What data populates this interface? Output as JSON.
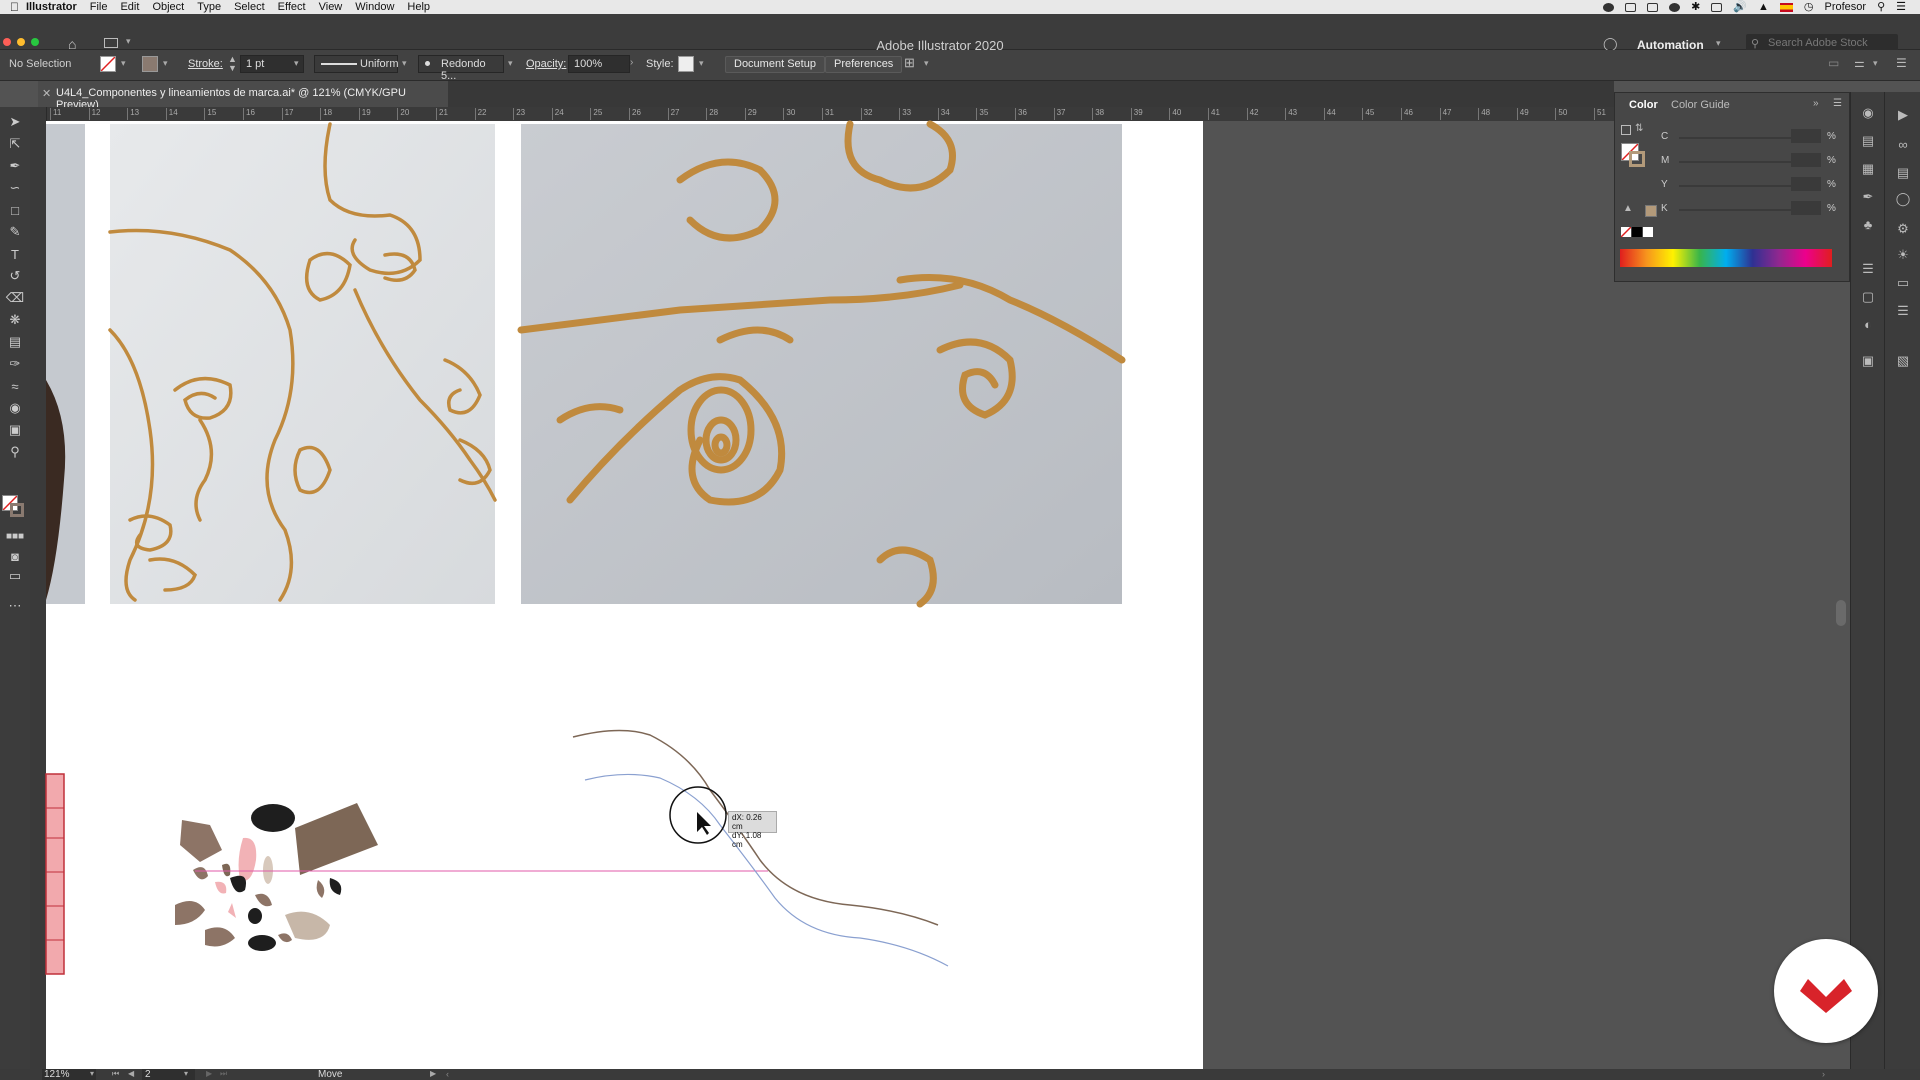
{
  "menubar": {
    "items": [
      "Illustrator",
      "File",
      "Edit",
      "Object",
      "Type",
      "Select",
      "Effect",
      "View",
      "Window",
      "Help"
    ],
    "user": "Profesor"
  },
  "titlebar": {
    "title": "Adobe Illustrator 2020",
    "workspace": "Automation",
    "stock_placeholder": "Search Adobe Stock"
  },
  "controlbar": {
    "selection": "No Selection",
    "stroke_label": "Stroke:",
    "stroke_value": "1 pt",
    "profile": "Uniform",
    "brush": "Redondo 5...",
    "opacity_label": "Opacity:",
    "opacity_value": "100%",
    "style_label": "Style:",
    "document_setup": "Document Setup",
    "preferences": "Preferences"
  },
  "document": {
    "tab_title": "U4L4_Componentes y lineamientos de marca.ai* @ 121% (CMYK/GPU Preview)"
  },
  "rulers": {
    "h_ticks": [
      "11",
      "12",
      "13",
      "14",
      "15",
      "16",
      "17",
      "18",
      "19",
      "20",
      "21",
      "22",
      "23",
      "24",
      "25",
      "26",
      "27",
      "28",
      "29",
      "30",
      "31",
      "32",
      "33",
      "34",
      "35",
      "36",
      "37",
      "38",
      "39",
      "40",
      "41",
      "42",
      "43",
      "44",
      "45",
      "46",
      "47",
      "48",
      "49",
      "50",
      "51"
    ]
  },
  "canvas": {
    "tooltip_dx": "dX: 0.26 cm",
    "tooltip_dy": "dY: 1.08 cm"
  },
  "color_panel": {
    "tabs": [
      "Color",
      "Color Guide"
    ],
    "channels": [
      "C",
      "M",
      "Y",
      "K"
    ],
    "percent": "%"
  },
  "statusbar": {
    "zoom": "121%",
    "artboard": "2",
    "tool": "Move"
  },
  "colors": {
    "accent_red": "#d8232a",
    "wire_gold": "#c08a3e",
    "path_brown": "#7d6756",
    "path_blue": "#8aa0d0"
  }
}
